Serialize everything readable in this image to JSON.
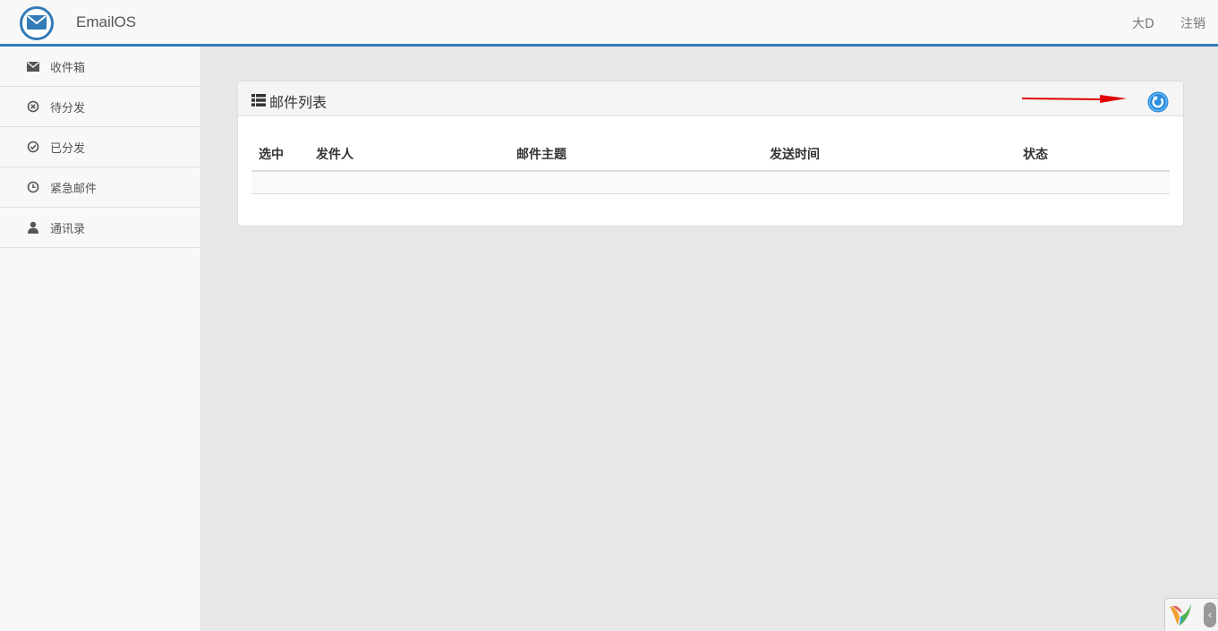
{
  "header": {
    "brand": "EmailOS",
    "user": "大D",
    "logout": "注销",
    "logo_icon": "envelope-icon",
    "accent_color": "#337ab7"
  },
  "sidebar": {
    "items": [
      {
        "label": "收件箱",
        "icon": "envelope-icon"
      },
      {
        "label": "待分发",
        "icon": "circle-x-icon"
      },
      {
        "label": "已分发",
        "icon": "circle-check-icon"
      },
      {
        "label": "紧急邮件",
        "icon": "clock-icon"
      },
      {
        "label": "通讯录",
        "icon": "user-icon"
      }
    ]
  },
  "panel": {
    "title": "邮件列表",
    "title_icon": "list-icon",
    "refresh_icon": "refresh-icon",
    "annotation_color": "#e00000"
  },
  "table": {
    "columns": [
      "选中",
      "发件人",
      "邮件主题",
      "发送时间",
      "状态"
    ],
    "rows": []
  }
}
